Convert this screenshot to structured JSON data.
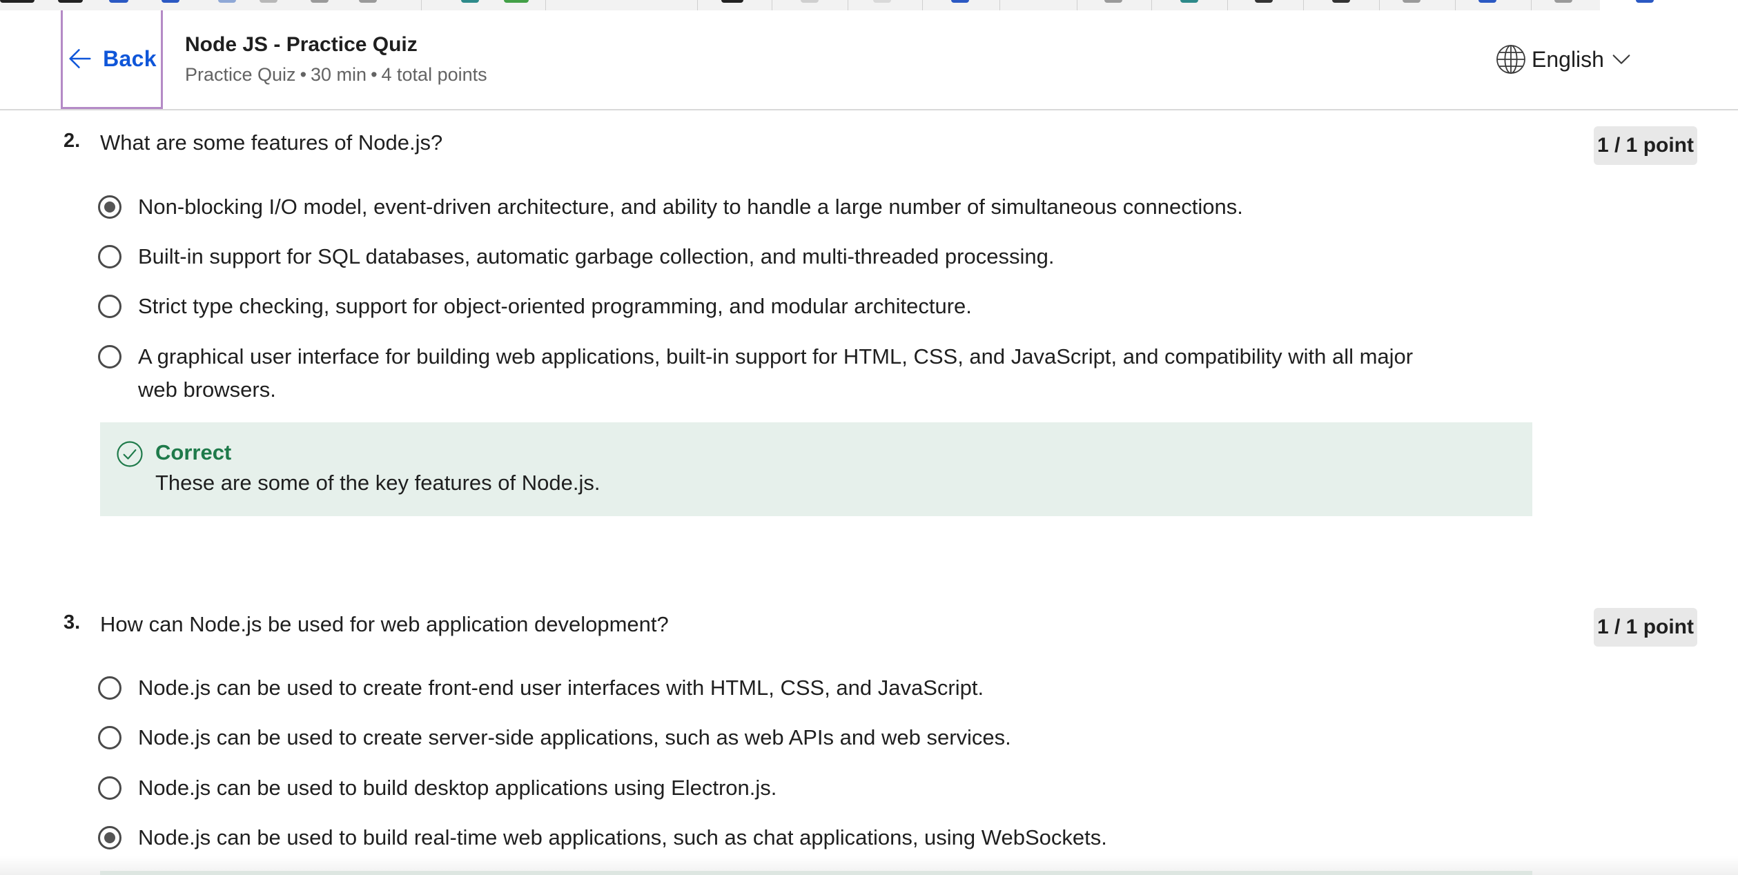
{
  "header": {
    "back_label": "Back",
    "title": "Node JS - Practice Quiz",
    "meta": {
      "type": "Practice Quiz",
      "separator": "•",
      "duration": "30 min",
      "points": "4 total points"
    },
    "language": "English"
  },
  "questions": [
    {
      "number": "2.",
      "text": "What are some features of Node.js?",
      "points": "1 / 1 point",
      "options": [
        {
          "label": "Non-blocking I/O model, event-driven architecture, and ability to handle a large number of simultaneous connections.",
          "selected": true
        },
        {
          "label": "Built-in support for SQL databases, automatic garbage collection, and multi-threaded processing.",
          "selected": false
        },
        {
          "label": "Strict type checking, support for object-oriented programming, and modular architecture.",
          "selected": false
        },
        {
          "label": "A graphical user interface for building web applications, built-in support for HTML, CSS, and JavaScript, and compatibility with all major web browsers.",
          "selected": false
        }
      ],
      "feedback": {
        "status": "Correct",
        "message": "These are some of the key features of Node.js."
      }
    },
    {
      "number": "3.",
      "text": "How can Node.js be used for web application development?",
      "points": "1 / 1 point",
      "options": [
        {
          "label": "Node.js can be used to create front-end user interfaces with HTML, CSS, and JavaScript.",
          "selected": false
        },
        {
          "label": "Node.js can be used to create server-side applications, such as web APIs and web services.",
          "selected": false
        },
        {
          "label": "Node.js can be used to build desktop applications using Electron.js.",
          "selected": false
        },
        {
          "label": "Node.js can be used to build real-time web applications, such as chat applications, using WebSockets.",
          "selected": true
        }
      ]
    }
  ],
  "colors": {
    "link_blue": "#0f56d9",
    "focus_outline": "#b48ac6",
    "correct_green": "#1e7a4a",
    "feedback_bg": "#e6f0eb",
    "badge_bg": "#e8e8e8"
  },
  "icons": {
    "back": "arrow-left-icon",
    "language": "globe-icon",
    "dropdown": "chevron-down-icon",
    "correct": "check-circle-icon"
  }
}
